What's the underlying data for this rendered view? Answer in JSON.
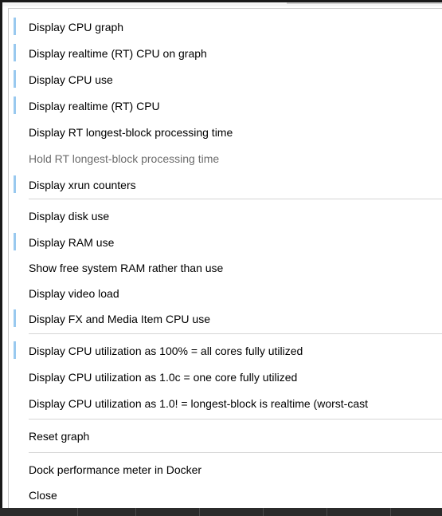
{
  "menu": {
    "items": [
      {
        "label": "Display CPU graph",
        "checked": true,
        "enabled": true
      },
      {
        "label": "Display realtime (RT) CPU on graph",
        "checked": true,
        "enabled": true
      },
      {
        "label": "Display CPU use",
        "checked": true,
        "enabled": true
      },
      {
        "label": "Display realtime (RT) CPU",
        "checked": true,
        "enabled": true
      },
      {
        "label": "Display RT longest-block processing time",
        "checked": false,
        "enabled": true
      },
      {
        "label": "Hold RT longest-block processing time",
        "checked": false,
        "enabled": false
      },
      {
        "label": "Display xrun counters",
        "checked": true,
        "enabled": true
      },
      {
        "label": "Display disk use",
        "checked": false,
        "enabled": true
      },
      {
        "label": "Display RAM use",
        "checked": true,
        "enabled": true
      },
      {
        "label": "Show free system RAM rather than use",
        "checked": false,
        "enabled": true
      },
      {
        "label": "Display video load",
        "checked": false,
        "enabled": true
      },
      {
        "label": "Display FX and Media Item CPU use",
        "checked": true,
        "enabled": true
      },
      {
        "label": "Display CPU utilization as 100% = all cores fully utilized",
        "checked": true,
        "enabled": true
      },
      {
        "label": "Display CPU utilization as 1.0c = one core fully utilized",
        "checked": false,
        "enabled": true
      },
      {
        "label": "Display CPU utilization as 1.0! = longest-block is realtime (worst-cast",
        "checked": false,
        "enabled": true
      },
      {
        "label": "Reset graph",
        "checked": false,
        "enabled": true
      },
      {
        "label": "Dock performance meter in Docker",
        "checked": false,
        "enabled": true
      },
      {
        "label": "Close",
        "checked": false,
        "enabled": true
      }
    ]
  },
  "colors": {
    "check_indicator": "#99c9ef",
    "text": "#000000",
    "disabled_text": "#6d6d6d",
    "separator": "#d5d5d5"
  }
}
